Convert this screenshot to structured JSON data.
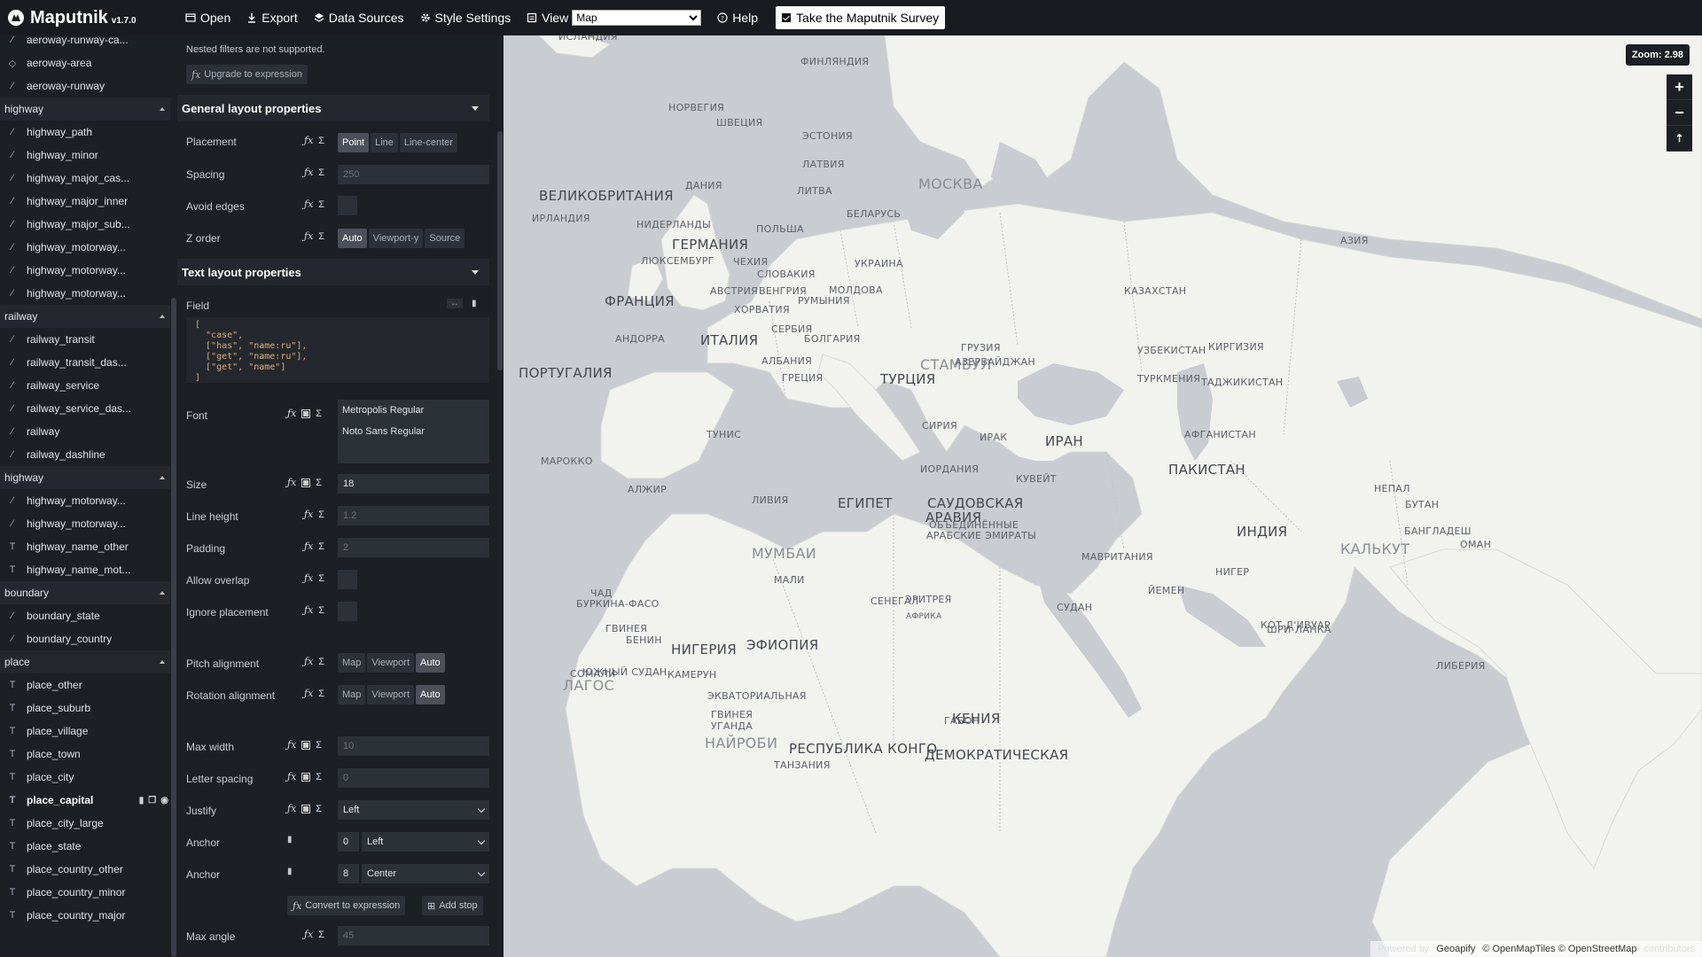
{
  "app": {
    "name": "Maputnik",
    "version": "v1.7.0"
  },
  "toolbar": {
    "open": "Open",
    "export": "Export",
    "data_sources": "Data Sources",
    "style_settings": "Style Settings",
    "view": "View",
    "view_value": "Map",
    "help": "Help",
    "survey": "Take the Maputnik Survey"
  },
  "layers": {
    "top_items": [
      "aeroway-runway-ca...",
      "aeroway-area",
      "aeroway-runway"
    ],
    "groups": [
      {
        "name": "highway",
        "items": [
          "highway_path",
          "highway_minor",
          "highway_major_cas...",
          "highway_major_inner",
          "highway_major_sub...",
          "highway_motorway...",
          "highway_motorway...",
          "highway_motorway..."
        ]
      },
      {
        "name": "railway",
        "items": [
          "railway_transit",
          "railway_transit_das...",
          "railway_service",
          "railway_service_das...",
          "railway",
          "railway_dashline"
        ]
      },
      {
        "name": "highway",
        "items": [
          "highway_motorway...",
          "highway_motorway...",
          "highway_name_other",
          "highway_name_mot..."
        ]
      },
      {
        "name": "boundary",
        "items": [
          "boundary_state",
          "boundary_country"
        ]
      },
      {
        "name": "place",
        "items": [
          "place_other",
          "place_suburb",
          "place_village",
          "place_town",
          "place_city",
          "place_capital",
          "place_city_large",
          "place_state",
          "place_country_other",
          "place_country_minor",
          "place_country_major"
        ]
      }
    ],
    "selected": "place_capital"
  },
  "editor": {
    "nested_note": "Nested filters are not supported.",
    "upgrade_btn": "Upgrade to expression",
    "general_title": "General layout properties",
    "placement_label": "Placement",
    "placement_options": [
      "Point",
      "Line",
      "Line-center"
    ],
    "spacing_label": "Spacing",
    "spacing_placeholder": "250",
    "avoid_edges_label": "Avoid edges",
    "z_order_label": "Z order",
    "z_order_options": [
      "Auto",
      "Viewport-y",
      "Source"
    ],
    "text_title": "Text layout properties",
    "field_label": "Field",
    "field_code": "[\n  \"case\",\n  [\"has\", \"name:ru\"],\n  [\"get\", \"name:ru\"],\n  [\"get\", \"name\"]\n]",
    "font_label": "Font",
    "fonts": [
      "Metropolis Regular",
      "Noto Sans Regular"
    ],
    "size_label": "Size",
    "size_value": "18",
    "line_height_label": "Line height",
    "line_height_placeholder": "1.2",
    "padding_label": "Padding",
    "padding_placeholder": "2",
    "allow_overlap_label": "Allow overlap",
    "ignore_placement_label": "Ignore placement",
    "pitch_alignment_label": "Pitch alignment",
    "rotation_alignment_label": "Rotation alignment",
    "alignment_options": [
      "Map",
      "Viewport",
      "Auto"
    ],
    "max_width_label": "Max width",
    "max_width_placeholder": "10",
    "letter_spacing_label": "Letter spacing",
    "letter_spacing_placeholder": "0",
    "justify_label": "Justify",
    "justify_value": "Left",
    "anchor_label": "Anchor",
    "anchor_stop_1": "0",
    "anchor_value_1": "Left",
    "anchor_stop_2": "8",
    "anchor_value_2": "Center",
    "convert_btn": "Convert to expression",
    "add_stop_btn": "Add stop",
    "max_angle_label": "Max angle",
    "max_angle_placeholder": "45"
  },
  "map": {
    "zoom_badge": "Zoom: 2.98",
    "attribution_faded": "Powered by",
    "attribution_geoapify": "Geoapify",
    "attribution_rest": "© OpenMapTiles © OpenStreetMap",
    "attribution_contributors": "contributors",
    "labels": [
      {
        "text": "ИСЛАНДИЯ",
        "size": "small"
      },
      {
        "text": "ФИНЛЯНДИЯ",
        "size": "small"
      },
      {
        "text": "НОРВЕГИЯ",
        "size": "small"
      },
      {
        "text": "ШВЕЦИЯ",
        "size": "small"
      },
      {
        "text": "ЭСТОНИЯ",
        "size": "small"
      },
      {
        "text": "ЛАТВИЯ",
        "size": "small"
      },
      {
        "text": "ДАНИЯ",
        "size": "small"
      },
      {
        "text": "ЛИТВА",
        "size": "small"
      },
      {
        "text": "МОСКВА",
        "size": "capital"
      },
      {
        "text": "ВЕЛИКОБРИТАНИЯ",
        "size": "large"
      },
      {
        "text": "ИРЛАНДИЯ",
        "size": "small"
      },
      {
        "text": "НИДЕРЛАНДЫ",
        "size": "small"
      },
      {
        "text": "БЕЛАРУСЬ",
        "size": "small"
      },
      {
        "text": "ГЕРМАНИЯ",
        "size": "large"
      },
      {
        "text": "ПОЛЬША",
        "size": "small"
      },
      {
        "text": "ЛЮКСЕМБУРГ",
        "size": "small"
      },
      {
        "text": "ЧЕХИЯ",
        "size": "small"
      },
      {
        "text": "УКРАИНА",
        "size": "small"
      },
      {
        "text": "СЛОВАКИЯ",
        "size": "small"
      },
      {
        "text": "АЗИЯ",
        "size": "small"
      },
      {
        "text": "ФРАНЦИЯ",
        "size": "large"
      },
      {
        "text": "АВСТРИЯ",
        "size": "small"
      },
      {
        "text": "ВЕНГРИЯ",
        "size": "small"
      },
      {
        "text": "МОЛДОВА",
        "size": "small"
      },
      {
        "text": "КАЗАХСТАН",
        "size": "small"
      },
      {
        "text": "ХОРВАТИЯ",
        "size": "small"
      },
      {
        "text": "РУМЫНИЯ",
        "size": "small"
      },
      {
        "text": "СЕРБИЯ",
        "size": "small"
      },
      {
        "text": "АНДОРРА",
        "size": "small"
      },
      {
        "text": "ИТАЛИЯ",
        "size": "large"
      },
      {
        "text": "БОЛГАРИЯ",
        "size": "small"
      },
      {
        "text": "ГРУЗИЯ",
        "size": "small"
      },
      {
        "text": "УЗБЕКИСТАН",
        "size": "small"
      },
      {
        "text": "КИРГИЗИЯ",
        "size": "small"
      },
      {
        "text": "ПОРТУГАЛИЯ",
        "size": "large"
      },
      {
        "text": "АЛБАНИЯ",
        "size": "small"
      },
      {
        "text": "СТАМБУЛ",
        "size": "capital"
      },
      {
        "text": "АЗЕРБАЙДЖАН",
        "size": "small"
      },
      {
        "text": "ГРЕЦИЯ",
        "size": "small"
      },
      {
        "text": "ТУРЦИЯ",
        "size": "large"
      },
      {
        "text": "ТУРКМЕНИЯ",
        "size": "small"
      },
      {
        "text": "ТАДЖИКИСТАН",
        "size": "small"
      },
      {
        "text": "ТУНИС",
        "size": "small"
      },
      {
        "text": "СИРИЯ",
        "size": "small"
      },
      {
        "text": "АФГАНИСТАН",
        "size": "small"
      },
      {
        "text": "ИРАК",
        "size": "small"
      },
      {
        "text": "ИРАН",
        "size": "large"
      },
      {
        "text": "МАРОККО",
        "size": "small"
      },
      {
        "text": "ИОРДАНИЯ",
        "size": "small"
      },
      {
        "text": "ПАКИСТАН",
        "size": "large"
      },
      {
        "text": "КУВЕЙТ",
        "size": "small"
      },
      {
        "text": "АЛЖИР",
        "size": "small"
      },
      {
        "text": "НЕПАЛ",
        "size": "small"
      },
      {
        "text": "ЛИВИЯ",
        "size": "small"
      },
      {
        "text": "ЕГИПЕТ",
        "size": "large"
      },
      {
        "text": "САУДОВСКАЯ",
        "size": "large"
      },
      {
        "text": "АРАВИЯ",
        "size": "large"
      },
      {
        "text": "БУТАН",
        "size": "small"
      },
      {
        "text": "ОБЪЕДИНЁННЫЕ",
        "size": "small"
      },
      {
        "text": "АРАБСКИЕ ЭМИРАТЫ",
        "size": "small"
      },
      {
        "text": "БАНГЛАДЕШ",
        "size": "small"
      },
      {
        "text": "ИНДИЯ",
        "size": "large"
      },
      {
        "text": "КАЛЬКУТ",
        "size": "capital"
      },
      {
        "text": "ОМАН",
        "size": "small"
      },
      {
        "text": "МАВРИТАНИЯ",
        "size": "small"
      },
      {
        "text": "МУМБАИ",
        "size": "capital"
      },
      {
        "text": "НИГЕР",
        "size": "small"
      },
      {
        "text": "МАЛИ",
        "size": "small"
      },
      {
        "text": "ЧАД",
        "size": "small"
      },
      {
        "text": "ЙЕМЕН",
        "size": "small"
      },
      {
        "text": "СЕНЕГАЛ",
        "size": "small"
      },
      {
        "text": "СУДАН",
        "size": "small"
      },
      {
        "text": "ЭРИТРЕЯ",
        "size": "small"
      },
      {
        "text": "БУРКИНА-ФАСО",
        "size": "small"
      },
      {
        "text": "АФРИКА",
        "size": "tiny"
      },
      {
        "text": "ГВИНЕЯ",
        "size": "small"
      },
      {
        "text": "БЕНИН",
        "size": "small"
      },
      {
        "text": "НИГЕРИЯ",
        "size": "large"
      },
      {
        "text": "ЭФИОПИЯ",
        "size": "large"
      },
      {
        "text": "КОТ-Д'ИВУАР",
        "size": "small"
      },
      {
        "text": "ЮЖНЫЙ СУДАН",
        "size": "small"
      },
      {
        "text": "СОМАЛИ",
        "size": "small"
      },
      {
        "text": "ШРИ-ЛАНКА",
        "size": "small"
      },
      {
        "text": "ЛИБЕРИЯ",
        "size": "small"
      },
      {
        "text": "ЛАГОС",
        "size": "capital"
      },
      {
        "text": "КАМЕРУН",
        "size": "small"
      },
      {
        "text": "ЭКВАТОРИАЛЬНАЯ",
        "size": "small"
      },
      {
        "text": "ГВИНЕЯ",
        "size": "small"
      },
      {
        "text": "УГАНДА",
        "size": "small"
      },
      {
        "text": "КЕНИЯ",
        "size": "large"
      },
      {
        "text": "ГАБОН",
        "size": "small"
      },
      {
        "text": "НАЙРОБИ",
        "size": "capital"
      },
      {
        "text": "ДЕМОКРАТИЧЕСКАЯ",
        "size": "large"
      },
      {
        "text": "РЕСПУБЛИКА КОНГО",
        "size": "large"
      },
      {
        "text": "ТАНЗАНИЯ",
        "size": "small"
      }
    ]
  }
}
